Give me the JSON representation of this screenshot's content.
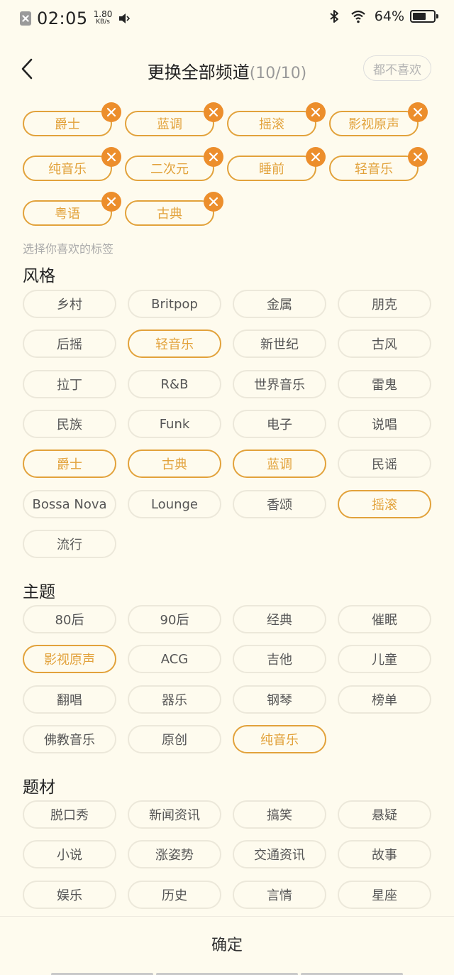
{
  "status_bar": {
    "time": "02:05",
    "speed_value": "1.80",
    "speed_unit": "KB/s",
    "battery_percent": "64%",
    "battery_level": 0.64
  },
  "header": {
    "title": "更换全部频道",
    "count": "(10/10)",
    "dislike_all_label": "都不喜欢"
  },
  "selected_tags": [
    "爵士",
    "蓝调",
    "摇滚",
    "影视原声",
    "纯音乐",
    "二次元",
    "睡前",
    "轻音乐",
    "粤语",
    "古典"
  ],
  "hint": "选择你喜欢的标签",
  "sections": [
    {
      "title": "风格",
      "chips": [
        {
          "label": "乡村",
          "selected": false
        },
        {
          "label": "Britpop",
          "selected": false
        },
        {
          "label": "金属",
          "selected": false
        },
        {
          "label": "朋克",
          "selected": false
        },
        {
          "label": "后摇",
          "selected": false
        },
        {
          "label": "轻音乐",
          "selected": true
        },
        {
          "label": "新世纪",
          "selected": false
        },
        {
          "label": "古风",
          "selected": false
        },
        {
          "label": "拉丁",
          "selected": false
        },
        {
          "label": "R&B",
          "selected": false
        },
        {
          "label": "世界音乐",
          "selected": false
        },
        {
          "label": "雷鬼",
          "selected": false
        },
        {
          "label": "民族",
          "selected": false
        },
        {
          "label": "Funk",
          "selected": false
        },
        {
          "label": "电子",
          "selected": false
        },
        {
          "label": "说唱",
          "selected": false
        },
        {
          "label": "爵士",
          "selected": true
        },
        {
          "label": "古典",
          "selected": true
        },
        {
          "label": "蓝调",
          "selected": true
        },
        {
          "label": "民谣",
          "selected": false
        },
        {
          "label": "Bossa Nova",
          "selected": false
        },
        {
          "label": "Lounge",
          "selected": false
        },
        {
          "label": "香颂",
          "selected": false
        },
        {
          "label": "摇滚",
          "selected": true
        },
        {
          "label": "流行",
          "selected": false
        }
      ]
    },
    {
      "title": "主题",
      "chips": [
        {
          "label": "80后",
          "selected": false
        },
        {
          "label": "90后",
          "selected": false
        },
        {
          "label": "经典",
          "selected": false
        },
        {
          "label": "催眠",
          "selected": false
        },
        {
          "label": "影视原声",
          "selected": true
        },
        {
          "label": "ACG",
          "selected": false
        },
        {
          "label": "吉他",
          "selected": false
        },
        {
          "label": "儿童",
          "selected": false
        },
        {
          "label": "翻唱",
          "selected": false
        },
        {
          "label": "器乐",
          "selected": false
        },
        {
          "label": "钢琴",
          "selected": false
        },
        {
          "label": "榜单",
          "selected": false
        },
        {
          "label": "佛教音乐",
          "selected": false
        },
        {
          "label": "原创",
          "selected": false
        },
        {
          "label": "纯音乐",
          "selected": true
        }
      ]
    },
    {
      "title": "题材",
      "chips": [
        {
          "label": "脱口秀",
          "selected": false
        },
        {
          "label": "新闻资讯",
          "selected": false
        },
        {
          "label": "搞笑",
          "selected": false
        },
        {
          "label": "悬疑",
          "selected": false
        },
        {
          "label": "小说",
          "selected": false
        },
        {
          "label": "涨姿势",
          "selected": false
        },
        {
          "label": "交通资讯",
          "selected": false
        },
        {
          "label": "故事",
          "selected": false
        },
        {
          "label": "娱乐",
          "selected": false
        },
        {
          "label": "历史",
          "selected": false
        },
        {
          "label": "言情",
          "selected": false
        },
        {
          "label": "星座",
          "selected": false
        }
      ]
    }
  ],
  "footer": {
    "confirm_label": "确定"
  },
  "colors": {
    "background": "#FEFBEE",
    "accent": "#E2A23B",
    "badge": "#EC8E2C",
    "chip_border": "#ECE8DA"
  },
  "icons": {
    "back": "chevron-left-icon",
    "remove": "close-icon",
    "sim": "no-sim-icon",
    "mute": "speaker-mute-icon",
    "bluetooth": "bluetooth-icon",
    "wifi": "wifi-icon",
    "battery": "battery-icon"
  }
}
